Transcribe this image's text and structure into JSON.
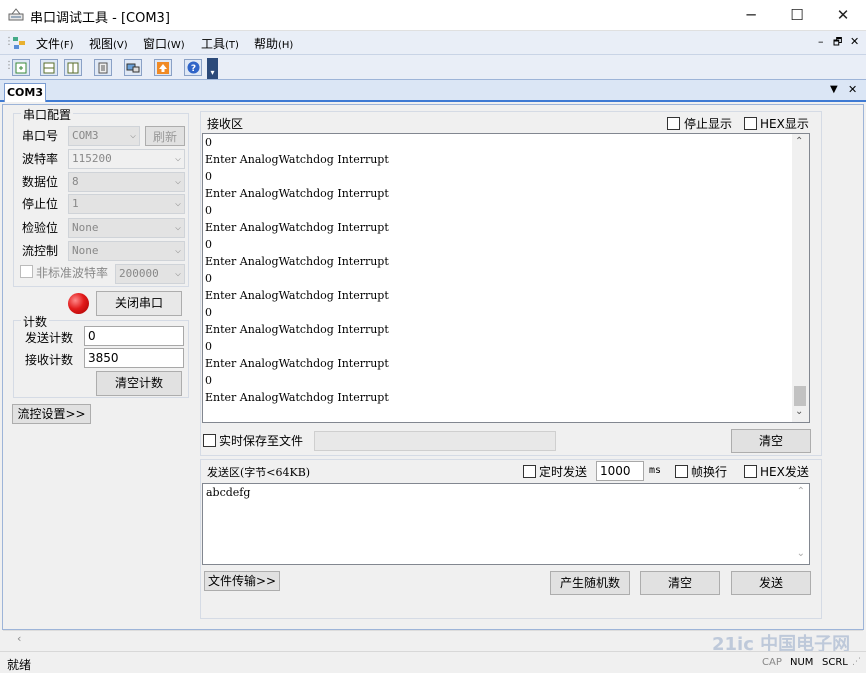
{
  "window": {
    "title": "串口调试工具 - [COM3]",
    "minimize": "─",
    "maximize": "☐",
    "close": "✕"
  },
  "menu": [
    {
      "label": "文件",
      "key": "(F)"
    },
    {
      "label": "视图",
      "key": "(V)"
    },
    {
      "label": "窗口",
      "key": "(W)"
    },
    {
      "label": "工具",
      "key": "(T)"
    },
    {
      "label": "帮助",
      "key": "(H)"
    }
  ],
  "mdi_controls": {
    "minimize": "–",
    "restore": "🗗",
    "close": "✕"
  },
  "toolbar_icons": [
    "new-icon",
    "split-horizontal-icon",
    "split-vertical-icon",
    "calculator-icon",
    "monitor-icon",
    "upload-icon",
    "help-icon"
  ],
  "tab": {
    "label": "COM3"
  },
  "serial_config": {
    "title": "串口配置",
    "port_label": "串口号",
    "port_value": "COM3",
    "refresh_button": "刷新",
    "baud_label": "波特率",
    "baud_value": "115200",
    "databits_label": "数据位",
    "databits_value": "8",
    "stopbits_label": "停止位",
    "stopbits_value": "1",
    "parity_label": "检验位",
    "parity_value": "None",
    "flow_label": "流控制",
    "flow_value": "None",
    "nonstandard_label": "非标准波特率",
    "nonstandard_value": "200000",
    "close_port_button": "关闭串口",
    "status_led_color": "#e21b1b"
  },
  "counter": {
    "title": "计数",
    "send_label": "发送计数",
    "send_value": "0",
    "recv_label": "接收计数",
    "recv_value": "3850",
    "clear_button": "清空计数"
  },
  "flow_settings_button": "流控设置>>",
  "receive": {
    "title": "接收区",
    "stop_display_label": "停止显示",
    "hex_display_label": "HEX显示",
    "lines": [
      "0",
      "Enter AnalogWatchdog Interrupt",
      "0",
      "Enter AnalogWatchdog Interrupt",
      "0",
      "Enter AnalogWatchdog Interrupt",
      "0",
      "Enter AnalogWatchdog Interrupt",
      "0",
      "Enter AnalogWatchdog Interrupt",
      "0",
      "Enter AnalogWatchdog Interrupt",
      "0",
      "Enter AnalogWatchdog Interrupt",
      "0",
      "Enter AnalogWatchdog Interrupt"
    ],
    "save_to_file_label": "实时保存至文件",
    "save_path": "",
    "clear_button": "清空"
  },
  "send": {
    "title": "发送区(字节<64KB)",
    "timed_send_label": "定时发送",
    "interval_value": "1000",
    "interval_unit": "ms",
    "newline_label": "帧换行",
    "hex_send_label": "HEX发送",
    "content": "abcdefg",
    "file_transfer_button": "文件传输>>",
    "random_button": "产生随机数",
    "clear_button": "清空",
    "send_button": "发送"
  },
  "statusbar": {
    "ready": "就绪",
    "cap": "CAP",
    "num": "NUM",
    "scrl": "SCRL"
  },
  "watermark": "21ic 中国电子网"
}
